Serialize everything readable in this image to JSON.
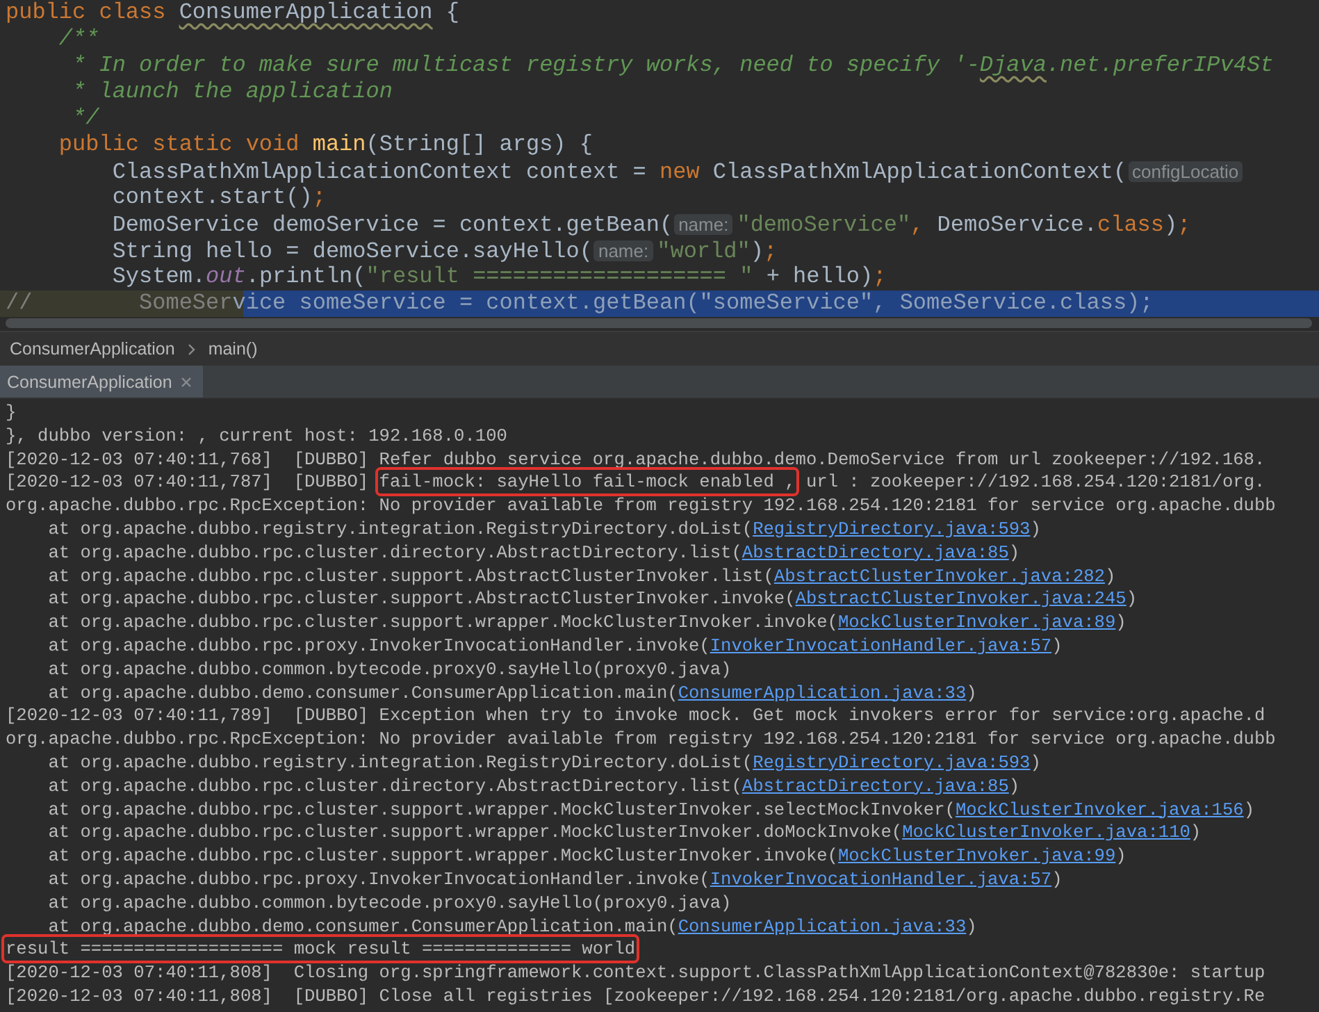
{
  "editor": {
    "lines": [
      {
        "segments": [
          {
            "kind": "keyword",
            "text": "public class "
          },
          {
            "kind": "typo",
            "text": "ConsumerApplication"
          },
          {
            "kind": "plain",
            "text": " {"
          }
        ]
      },
      {
        "segments": [
          {
            "kind": "doc",
            "text": "    /**"
          }
        ]
      },
      {
        "segments": [
          {
            "kind": "doc",
            "text": "     * In order to make sure multicast registry works, need to specify '-"
          },
          {
            "kind": "doc-typo",
            "text": "Djava"
          },
          {
            "kind": "doc",
            "text": ".net.preferIPv4St"
          }
        ]
      },
      {
        "segments": [
          {
            "kind": "doc",
            "text": "     * launch the application"
          }
        ]
      },
      {
        "segments": [
          {
            "kind": "doc",
            "text": "     */"
          }
        ]
      },
      {
        "segments": [
          {
            "kind": "keyword",
            "text": "    public static void "
          },
          {
            "kind": "method",
            "text": "main"
          },
          {
            "kind": "plain",
            "text": "(String[] args) {"
          }
        ]
      },
      {
        "segments": [
          {
            "kind": "plain",
            "text": "        ClassPathXmlApplicationContext context = "
          },
          {
            "kind": "keyword",
            "text": "new"
          },
          {
            "kind": "plain",
            "text": " ClassPathXmlApplicationContext("
          },
          {
            "kind": "hint",
            "text": "configLocatio"
          }
        ]
      },
      {
        "segments": [
          {
            "kind": "plain",
            "text": "        context.start()"
          },
          {
            "kind": "keyword",
            "text": ";"
          }
        ]
      },
      {
        "segments": [
          {
            "kind": "plain",
            "text": "        DemoService demoService = context.getBean("
          },
          {
            "kind": "hint",
            "text": "name:"
          },
          {
            "kind": "string",
            "text": "\"demoService\""
          },
          {
            "kind": "keyword",
            "text": ","
          },
          {
            "kind": "plain",
            "text": " DemoService."
          },
          {
            "kind": "keyword",
            "text": "class"
          },
          {
            "kind": "plain",
            "text": ")"
          },
          {
            "kind": "keyword",
            "text": ";"
          }
        ]
      },
      {
        "segments": [
          {
            "kind": "plain",
            "text": "        String hello = demoService.sayHello("
          },
          {
            "kind": "hint",
            "text": "name:"
          },
          {
            "kind": "string",
            "text": "\"world\""
          },
          {
            "kind": "plain",
            "text": ")"
          },
          {
            "kind": "keyword",
            "text": ";"
          }
        ]
      },
      {
        "segments": [
          {
            "kind": "plain",
            "text": "        System."
          },
          {
            "kind": "field",
            "text": "out"
          },
          {
            "kind": "plain",
            "text": ".println("
          },
          {
            "kind": "string",
            "text": "\"result =================== \""
          },
          {
            "kind": "plain",
            "text": " + hello)"
          },
          {
            "kind": "keyword",
            "text": ";"
          }
        ]
      },
      {
        "segments": [
          {
            "kind": "comment",
            "text": "//        SomeSer"
          },
          {
            "kind": "selected-comment",
            "text": "vice someService = context.getBean(\"someService\", SomeService.class);"
          }
        ]
      }
    ]
  },
  "breadcrumbs": [
    "ConsumerApplication",
    "main()"
  ],
  "run_tabs": [
    {
      "label": "ConsumerApplication",
      "selected": true
    }
  ],
  "console": {
    "lines": [
      {
        "segments": [
          {
            "kind": "text",
            "text": "}"
          }
        ]
      },
      {
        "segments": [
          {
            "kind": "text",
            "text": "}, dubbo version: , current host: 192.168.0.100"
          }
        ]
      },
      {
        "segments": [
          {
            "kind": "text",
            "text": "[2020-12-03 07:40:11,768]  [DUBBO] Refer dubbo service org.apache.dubbo.demo.DemoService from url zookeeper://192.168."
          }
        ]
      },
      {
        "segments": [
          {
            "kind": "text",
            "text": "[2020-12-03 07:40:11,787]  [DUBBO] "
          },
          {
            "kind": "boxed",
            "text": "fail-mock: sayHello fail-mock enabled ,"
          },
          {
            "kind": "text",
            "text": " url : zookeeper://192.168.254.120:2181/org."
          }
        ]
      },
      {
        "segments": [
          {
            "kind": "text",
            "text": "org.apache.dubbo.rpc.RpcException: No provider available from registry 192.168.254.120:2181 for service org.apache.dubb"
          }
        ]
      },
      {
        "segments": [
          {
            "kind": "text",
            "text": "    at org.apache.dubbo.registry.integration.RegistryDirectory.doList("
          },
          {
            "kind": "link",
            "text": "RegistryDirectory.java:593"
          },
          {
            "kind": "text",
            "text": ")"
          }
        ]
      },
      {
        "segments": [
          {
            "kind": "text",
            "text": "    at org.apache.dubbo.rpc.cluster.directory.AbstractDirectory.list("
          },
          {
            "kind": "link",
            "text": "AbstractDirectory.java:85"
          },
          {
            "kind": "text",
            "text": ")"
          }
        ]
      },
      {
        "segments": [
          {
            "kind": "text",
            "text": "    at org.apache.dubbo.rpc.cluster.support.AbstractClusterInvoker.list("
          },
          {
            "kind": "link",
            "text": "AbstractClusterInvoker.java:282"
          },
          {
            "kind": "text",
            "text": ")"
          }
        ]
      },
      {
        "segments": [
          {
            "kind": "text",
            "text": "    at org.apache.dubbo.rpc.cluster.support.AbstractClusterInvoker.invoke("
          },
          {
            "kind": "link",
            "text": "AbstractClusterInvoker.java:245"
          },
          {
            "kind": "text",
            "text": ")"
          }
        ]
      },
      {
        "segments": [
          {
            "kind": "text",
            "text": "    at org.apache.dubbo.rpc.cluster.support.wrapper.MockClusterInvoker.invoke("
          },
          {
            "kind": "link",
            "text": "MockClusterInvoker.java:89"
          },
          {
            "kind": "text",
            "text": ")"
          }
        ]
      },
      {
        "segments": [
          {
            "kind": "text",
            "text": "    at org.apache.dubbo.rpc.proxy.InvokerInvocationHandler.invoke("
          },
          {
            "kind": "link",
            "text": "InvokerInvocationHandler.java:57"
          },
          {
            "kind": "text",
            "text": ")"
          }
        ]
      },
      {
        "segments": [
          {
            "kind": "text",
            "text": "    at org.apache.dubbo.common.bytecode.proxy0.sayHello(proxy0.java)"
          }
        ]
      },
      {
        "segments": [
          {
            "kind": "text",
            "text": "    at org.apache.dubbo.demo.consumer.ConsumerApplication.main("
          },
          {
            "kind": "link",
            "text": "ConsumerApplication.java:33"
          },
          {
            "kind": "text",
            "text": ")"
          }
        ]
      },
      {
        "segments": [
          {
            "kind": "text",
            "text": "[2020-12-03 07:40:11,789]  [DUBBO] Exception when try to invoke mock. Get mock invokers error for service:org.apache.d"
          }
        ]
      },
      {
        "segments": [
          {
            "kind": "text",
            "text": "org.apache.dubbo.rpc.RpcException: No provider available from registry 192.168.254.120:2181 for service org.apache.dubb"
          }
        ]
      },
      {
        "segments": [
          {
            "kind": "text",
            "text": "    at org.apache.dubbo.registry.integration.RegistryDirectory.doList("
          },
          {
            "kind": "link",
            "text": "RegistryDirectory.java:593"
          },
          {
            "kind": "text",
            "text": ")"
          }
        ]
      },
      {
        "segments": [
          {
            "kind": "text",
            "text": "    at org.apache.dubbo.rpc.cluster.directory.AbstractDirectory.list("
          },
          {
            "kind": "link",
            "text": "AbstractDirectory.java:85"
          },
          {
            "kind": "text",
            "text": ")"
          }
        ]
      },
      {
        "segments": [
          {
            "kind": "text",
            "text": "    at org.apache.dubbo.rpc.cluster.support.wrapper.MockClusterInvoker.selectMockInvoker("
          },
          {
            "kind": "link",
            "text": "MockClusterInvoker.java:156"
          },
          {
            "kind": "text",
            "text": ")"
          }
        ]
      },
      {
        "segments": [
          {
            "kind": "text",
            "text": "    at org.apache.dubbo.rpc.cluster.support.wrapper.MockClusterInvoker.doMockInvoke("
          },
          {
            "kind": "link",
            "text": "MockClusterInvoker.java:110"
          },
          {
            "kind": "text",
            "text": ")"
          }
        ]
      },
      {
        "segments": [
          {
            "kind": "text",
            "text": "    at org.apache.dubbo.rpc.cluster.support.wrapper.MockClusterInvoker.invoke("
          },
          {
            "kind": "link",
            "text": "MockClusterInvoker.java:99"
          },
          {
            "kind": "text",
            "text": ")"
          }
        ]
      },
      {
        "segments": [
          {
            "kind": "text",
            "text": "    at org.apache.dubbo.rpc.proxy.InvokerInvocationHandler.invoke("
          },
          {
            "kind": "link",
            "text": "InvokerInvocationHandler.java:57"
          },
          {
            "kind": "text",
            "text": ")"
          }
        ]
      },
      {
        "segments": [
          {
            "kind": "text",
            "text": "    at org.apache.dubbo.common.bytecode.proxy0.sayHello(proxy0.java)"
          }
        ]
      },
      {
        "segments": [
          {
            "kind": "text",
            "text": "    at org.apache.dubbo.demo.consumer.ConsumerApplication.main("
          },
          {
            "kind": "link",
            "text": "ConsumerApplication.java:33"
          },
          {
            "kind": "text",
            "text": ")"
          }
        ]
      },
      {
        "segments": [
          {
            "kind": "boxed",
            "text": "result =================== mock result ============== world"
          }
        ]
      },
      {
        "segments": [
          {
            "kind": "text",
            "text": "[2020-12-03 07:40:11,808]  Closing org.springframework.context.support.ClassPathXmlApplicationContext@782830e: startup"
          }
        ]
      },
      {
        "segments": [
          {
            "kind": "text",
            "text": "[2020-12-03 07:40:11,808]  [DUBBO] Close all registries [zookeeper://192.168.254.120:2181/org.apache.dubbo.registry.Re"
          }
        ]
      }
    ]
  }
}
